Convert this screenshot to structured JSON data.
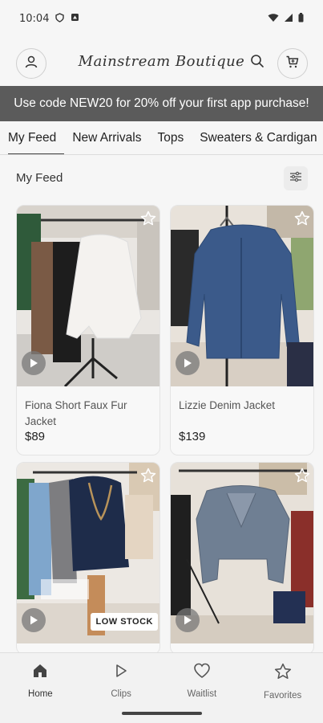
{
  "status": {
    "time": "10:04"
  },
  "header": {
    "logo": "Mainstream Boutique"
  },
  "promo": {
    "text": "Use code NEW20 for 20% off your first app purchase!"
  },
  "tabs": [
    {
      "label": "My Feed",
      "active": true
    },
    {
      "label": "New Arrivals"
    },
    {
      "label": "Tops"
    },
    {
      "label": "Sweaters & Cardigan"
    }
  ],
  "section": {
    "title": "My Feed"
  },
  "products": [
    {
      "name": "Fiona Short Faux Fur Jacket",
      "price": "$89"
    },
    {
      "name": "Lizzie Denim Jacket",
      "price": "$139"
    },
    {
      "name": "",
      "price": "",
      "badge": "LOW STOCK"
    },
    {
      "name": "",
      "price": ""
    }
  ],
  "bottom_nav": [
    {
      "label": "Home",
      "icon": "home-icon"
    },
    {
      "label": "Clips",
      "icon": "play-icon"
    },
    {
      "label": "Waitlist",
      "icon": "heart-icon"
    },
    {
      "label": "Favorites",
      "icon": "star-icon"
    }
  ],
  "colors": {
    "banner": "#5b5b5b",
    "accent": "#444444",
    "background": "#f6f6f6"
  }
}
